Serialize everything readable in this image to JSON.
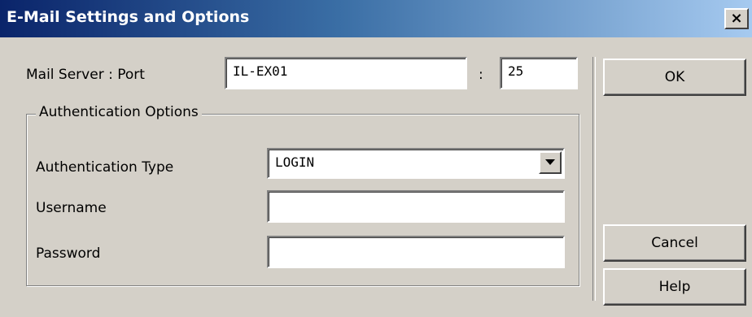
{
  "window": {
    "title": "E-Mail Settings and Options",
    "close_glyph": "×"
  },
  "server": {
    "label": "Mail Server : Port",
    "host_value": "IL-EX01",
    "separator": ":",
    "port_value": "25"
  },
  "auth": {
    "group_label": "Authentication Options",
    "type_label": "Authentication Type",
    "type_value": "LOGIN",
    "username_label": "Username",
    "username_value": "",
    "password_label": "Password",
    "password_value": ""
  },
  "buttons": {
    "ok": "OK",
    "cancel": "Cancel",
    "help": "Help"
  },
  "icons": {
    "close": "close-icon",
    "dropdown": "chevron-down-icon"
  }
}
